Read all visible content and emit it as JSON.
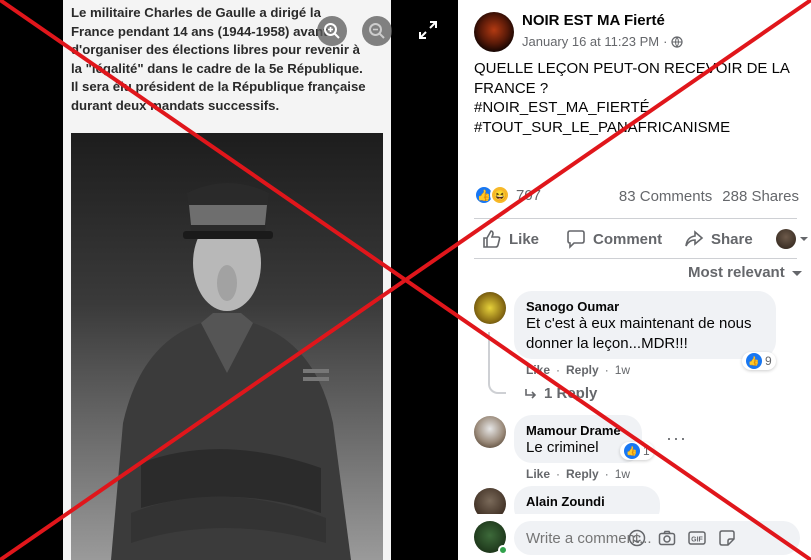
{
  "image": {
    "caption_lines": [
      "Le militaire Charles de Gaulle a dirigé la",
      "France pendant 14 ans (1944-1958) avant",
      "d'organiser des élections libres pour revenir à",
      "la \"légalité\" dans le cadre de la 5e République.",
      "Il sera élu président de la République française",
      "durant deux mandats successifs."
    ]
  },
  "post": {
    "page_name": "NOIR EST MA Fierté",
    "date": "January 16 at 11:23 PM",
    "separator": "·",
    "text_lines": [
      "QUELLE LEÇON PEUT-ON RECEVOIR DE LA",
      "FRANCE ?",
      "",
      "#NOIR_EST_MA_FIERTÉ",
      "#TOUT_SUR_LE_PANAFRICANISME"
    ],
    "reaction_count": "707",
    "comments_count": "83 Comments",
    "shares_count": "288 Shares"
  },
  "actions": {
    "like": "Like",
    "comment": "Comment",
    "share": "Share"
  },
  "sort_label": "Most relevant",
  "comments": [
    {
      "author": "Sanogo Oumar",
      "text_lines": [
        "Et c'est à eux maintenant de nous",
        "donner la leçon...MDR!!!"
      ],
      "like": "Like",
      "reply": "Reply",
      "time": "1w",
      "reactions": "9",
      "replies": "1 Reply"
    },
    {
      "author": "Mamour Drame",
      "text_lines": [
        "Le criminel"
      ],
      "like": "Like",
      "reply": "Reply",
      "time": "1w",
      "reactions": "1"
    },
    {
      "author": "Alain Zoundi"
    }
  ],
  "composer": {
    "placeholder": "Write a comment..."
  },
  "colors": {
    "accent": "#1877f2",
    "overlay_red": "#e0161b",
    "online": "#31a24c"
  },
  "icons": [
    "zoom-in-icon",
    "zoom-out-icon",
    "fullscreen-icon",
    "globe-icon",
    "like-icon",
    "comment-icon",
    "share-icon",
    "chevron-down-icon",
    "emoji-icon",
    "camera-icon",
    "gif-icon",
    "sticker-icon"
  ]
}
